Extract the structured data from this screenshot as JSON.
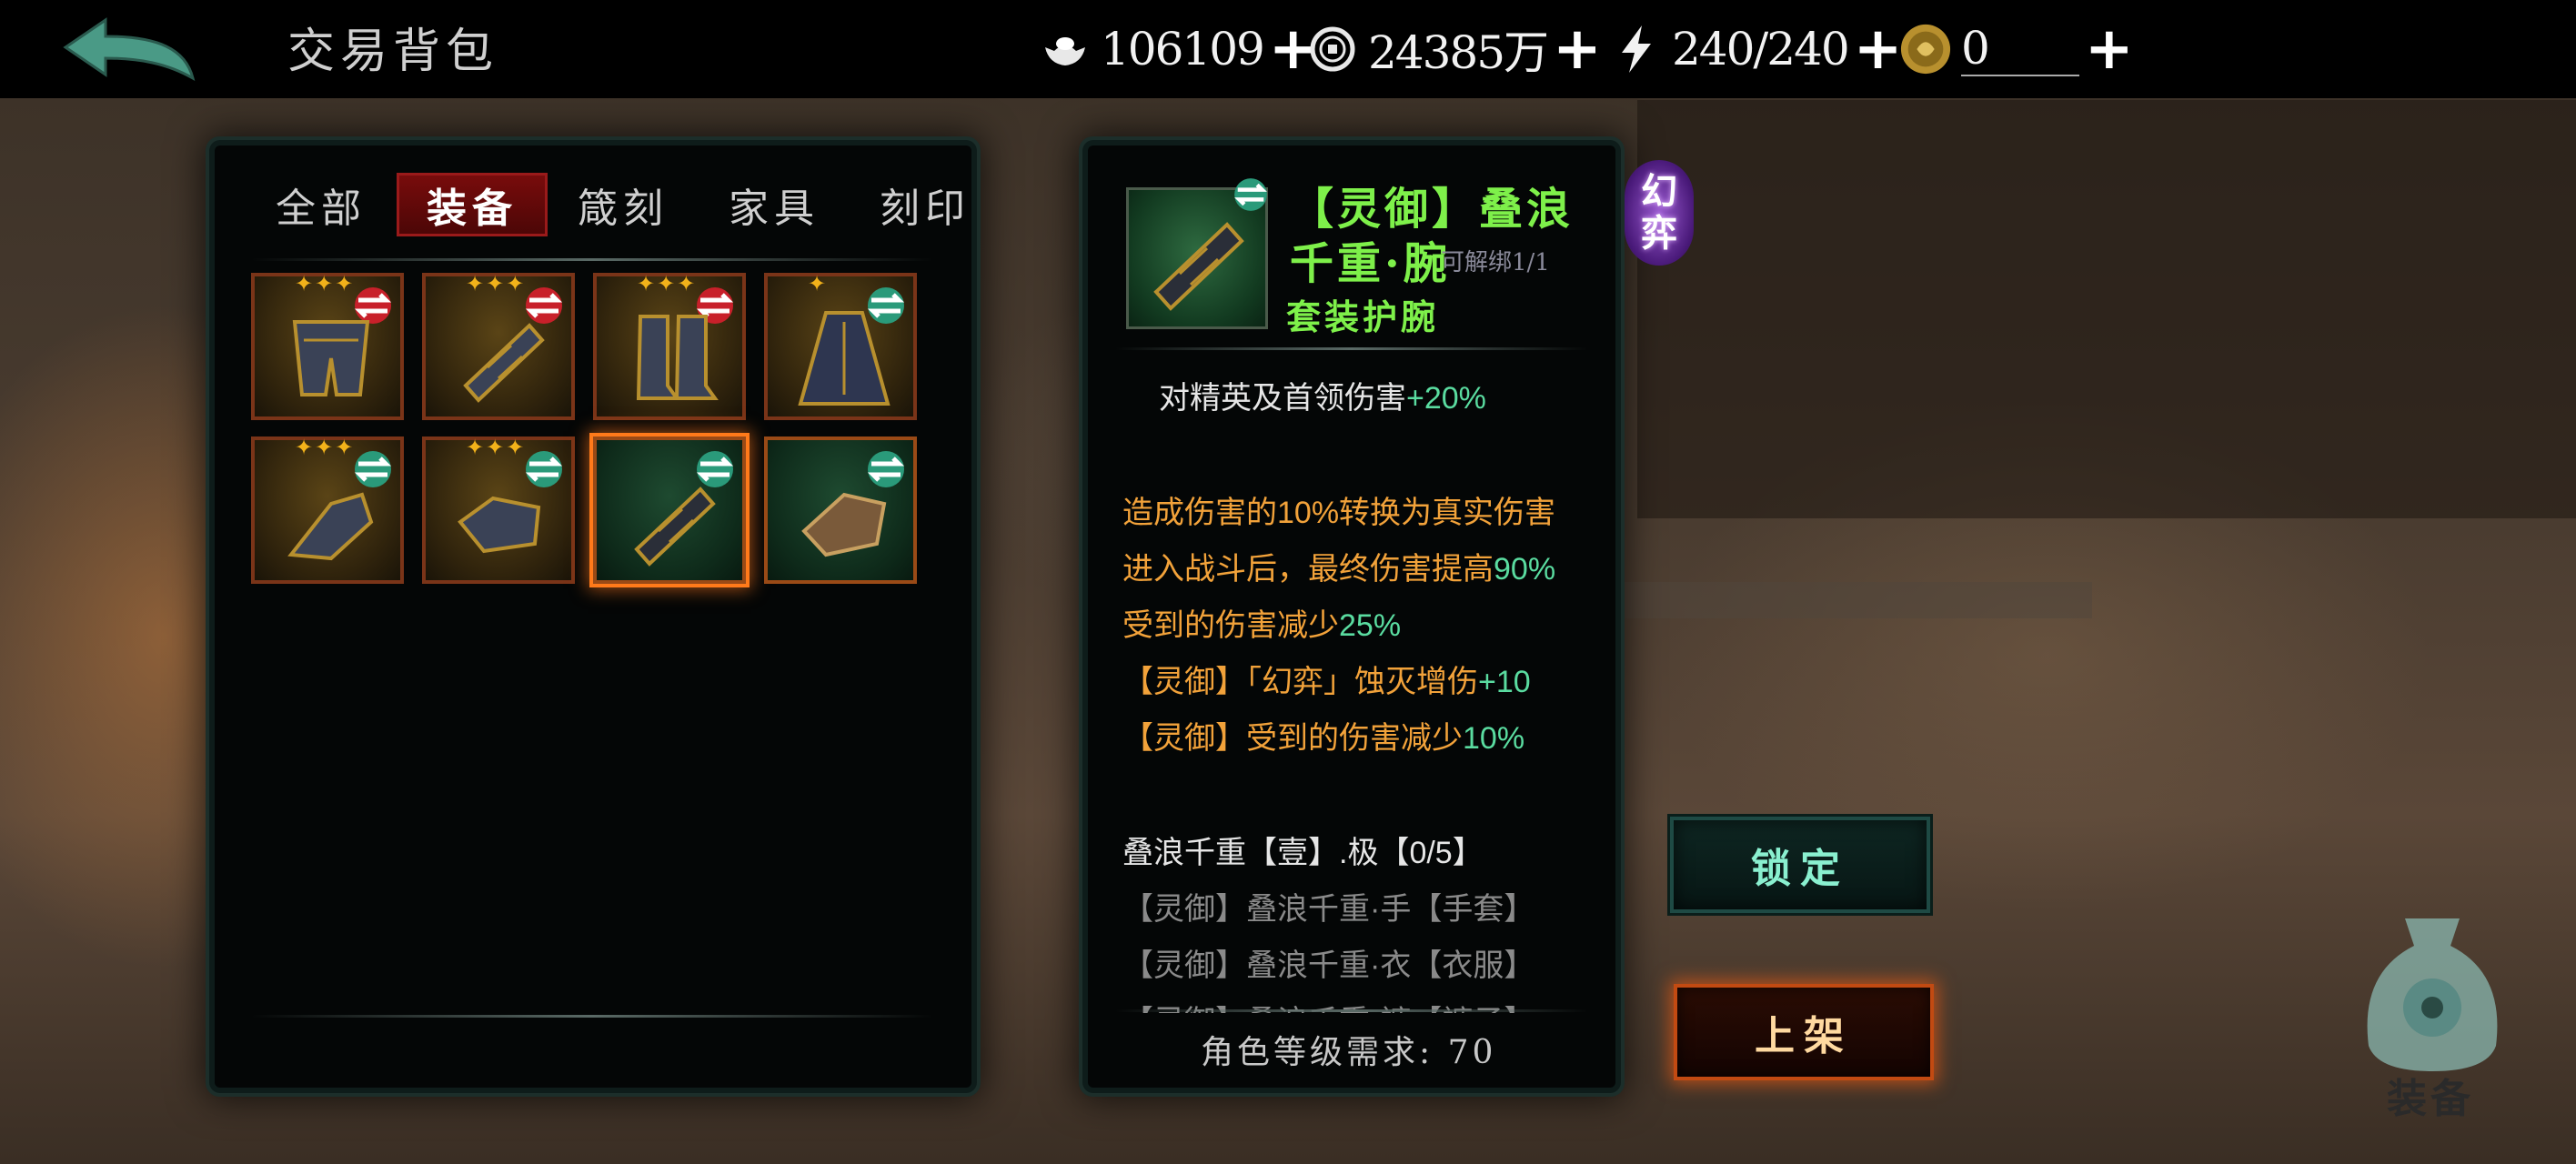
{
  "header": {
    "title": "交易背包",
    "resources": [
      {
        "icon": "silver-ingot-icon",
        "value": "106109",
        "plus": "+"
      },
      {
        "icon": "copper-coin-icon",
        "value": "24385万",
        "plus": "+"
      },
      {
        "icon": "lightning-icon",
        "value": "240/240",
        "plus": "+"
      },
      {
        "icon": "gold-medallion-icon",
        "value": "0",
        "plus": "+"
      }
    ]
  },
  "tabs": [
    {
      "label": "全部",
      "active": false
    },
    {
      "label": "装备",
      "active": true
    },
    {
      "label": "箴刻",
      "active": false
    },
    {
      "label": "家具",
      "active": false
    },
    {
      "label": "刻印",
      "active": false
    }
  ],
  "inventory": [
    {
      "name": "armored-legs",
      "stars": "✦✦✦",
      "swap": "red",
      "bg": "gold"
    },
    {
      "name": "bracer",
      "stars": "✦✦✦",
      "swap": "red",
      "bg": "gold"
    },
    {
      "name": "armored-boots",
      "stars": "✦✦✦",
      "swap": "red",
      "bg": "gold"
    },
    {
      "name": "cloak-armor",
      "stars": "✦",
      "swap": "green",
      "bg": "gold"
    },
    {
      "name": "gauntlet",
      "stars": "✦✦✦",
      "swap": "green",
      "bg": "gold"
    },
    {
      "name": "gauntlet-2",
      "stars": "✦✦✦",
      "swap": "green",
      "bg": "gold"
    },
    {
      "name": "bracer-selected",
      "stars": "",
      "swap": "green",
      "bg": "green",
      "selected": true
    },
    {
      "name": "glove-bronze",
      "stars": "",
      "swap": "green",
      "bg": "green"
    }
  ],
  "detail": {
    "name": "【灵御】叠浪千重·腕",
    "bind": "可解绑1/1",
    "subtype": "套装护腕",
    "badge": "幻弈",
    "base_stat_text": "对精英及首领伤害",
    "base_stat_value": "+20%",
    "affixes": [
      {
        "text": "造成伤害的10%转换为真实伤害",
        "value": ""
      },
      {
        "text": "进入战斗后，最终伤害提高",
        "value": "90%"
      },
      {
        "text": "受到的伤害减少",
        "value": "25%"
      },
      {
        "text": "【灵御】「幻弈」蚀灭增伤",
        "value": "+10"
      },
      {
        "text": "【灵御】受到的伤害减少",
        "value": "10%"
      }
    ],
    "set_title": "叠浪千重【壹】.极【0/5】",
    "set_items": [
      "【灵御】叠浪千重·手【手套】",
      "【灵御】叠浪千重·衣【衣服】",
      "【灵御】叠浪千重·裤【裤子】"
    ],
    "requirement": "角色等级需求: 70"
  },
  "buttons": {
    "lock": "锁定",
    "sell": "上架"
  },
  "equip_button_label": "装备",
  "colors": {
    "accent_green": "#7ef04a",
    "affix_orange": "#f2a23a",
    "value_green": "#5adca0",
    "tab_active": "#7a0c0c"
  }
}
